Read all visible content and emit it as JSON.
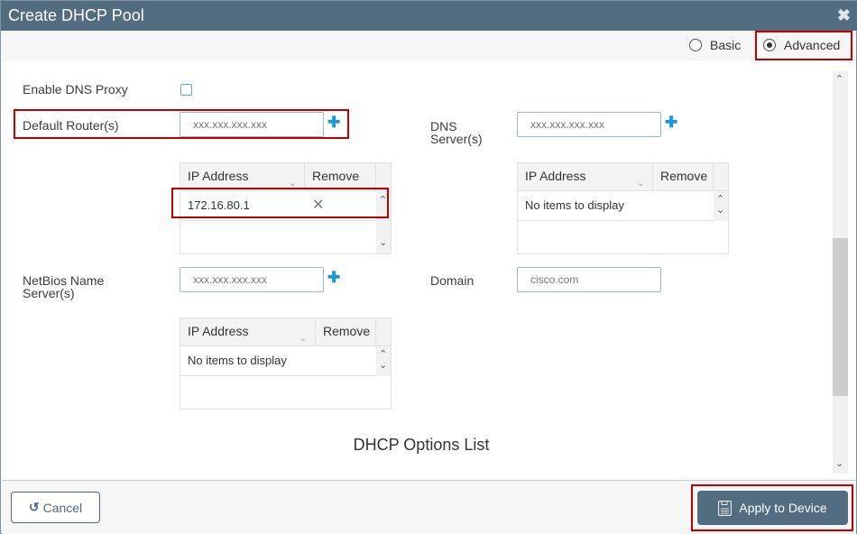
{
  "dialog": {
    "title": "Create DHCP Pool",
    "close_icon": "close-icon"
  },
  "mode": {
    "options": [
      {
        "label": "Basic",
        "selected": false
      },
      {
        "label": "Advanced",
        "selected": true
      }
    ]
  },
  "form": {
    "enable_dns_proxy": {
      "label": "Enable DNS Proxy",
      "checked": false
    },
    "default_router": {
      "label": "Default Router(s)",
      "placeholder": "xxx.xxx.xxx.xxx",
      "value": "",
      "add_icon": "plus-icon",
      "table": {
        "columns": [
          "IP Address",
          "Remove"
        ],
        "rows": [
          {
            "ip": "172.16.80.1",
            "remove_icon": "x-icon"
          }
        ]
      }
    },
    "dns_servers": {
      "label_line1": "DNS",
      "label_line2": "Server(s)",
      "placeholder": "xxx.xxx.xxx.xxx",
      "value": "",
      "add_icon": "plus-icon",
      "table": {
        "columns": [
          "IP Address",
          "Remove"
        ],
        "empty_text": "No items to display"
      }
    },
    "netbios": {
      "label_line1": "NetBios Name",
      "label_line2": "Server(s)",
      "placeholder": "xxx.xxx.xxx.xxx",
      "value": "",
      "add_icon": "plus-icon",
      "table": {
        "columns": [
          "IP Address",
          "Remove"
        ],
        "empty_text": "No items to display"
      }
    },
    "domain": {
      "label": "Domain",
      "placeholder": "cisco.com",
      "value": ""
    },
    "dhcp_options_title": "DHCP Options List"
  },
  "footer": {
    "cancel_label": "Cancel",
    "apply_label": "Apply to Device"
  },
  "colors": {
    "titlebar": "#526c80",
    "accent_plus": "#1b9ad6",
    "highlight": "#c00000"
  }
}
